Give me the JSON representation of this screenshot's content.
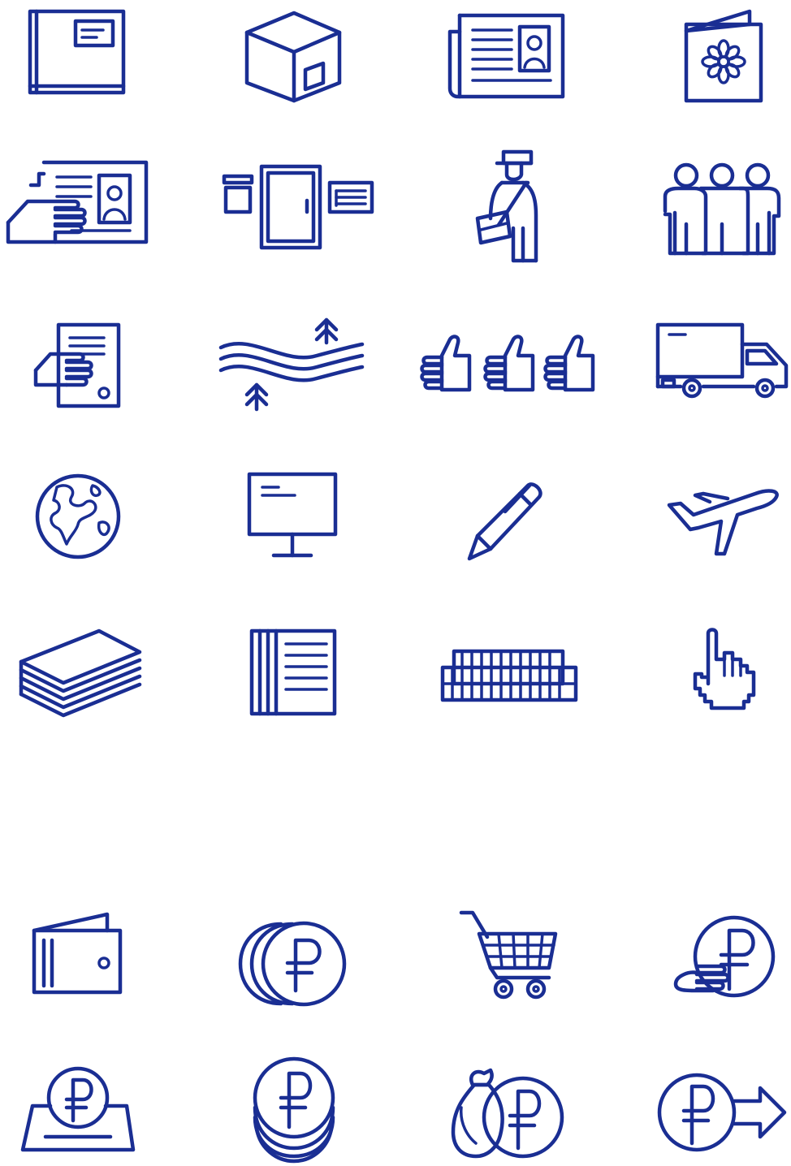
{
  "theme": {
    "icon_color": "#1a2e93",
    "background": "#ffffff"
  },
  "icon_groups": [
    {
      "name": "postal-and-delivery",
      "icons": [
        "book-icon",
        "parcel-box-icon",
        "newspaper-icon",
        "greeting-card-icon",
        "newspaper-in-hand-icon",
        "post-office-box-icon",
        "postman-icon",
        "group-of-people-icon",
        "document-in-hand-icon",
        "waves-with-trees-icon",
        "thumbs-up-row-icon",
        "delivery-truck-icon",
        "globe-icon",
        "monitor-icon",
        "pen-icon",
        "airplane-icon",
        "paper-stack-icon",
        "notebook-page-icon",
        "coin-stacks-icon",
        "pointer-hand-icon"
      ]
    },
    {
      "name": "finance",
      "icons": [
        "wallet-icon",
        "ruble-coins-icon",
        "shopping-cart-icon",
        "ruble-coin-in-hand-icon",
        "ruble-coin-slot-icon",
        "ruble-coin-stack-icon",
        "money-bag-ruble-icon",
        "ruble-transfer-arrow-icon"
      ]
    }
  ]
}
